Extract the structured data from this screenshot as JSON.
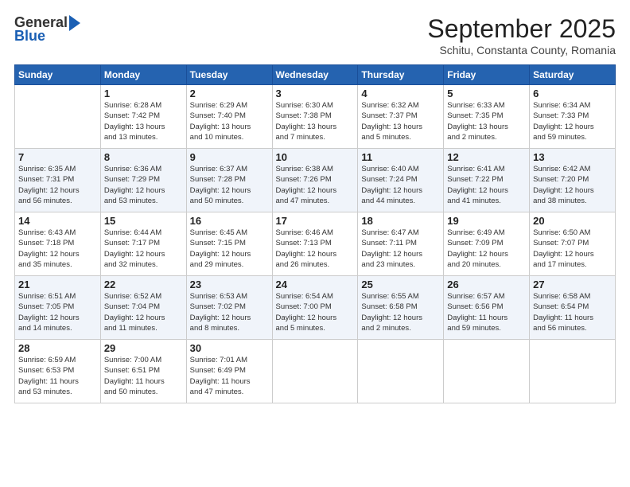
{
  "header": {
    "logo_general": "General",
    "logo_blue": "Blue",
    "month_title": "September 2025",
    "subtitle": "Schitu, Constanta County, Romania"
  },
  "weekdays": [
    "Sunday",
    "Monday",
    "Tuesday",
    "Wednesday",
    "Thursday",
    "Friday",
    "Saturday"
  ],
  "weeks": [
    [
      {
        "day": "",
        "info": ""
      },
      {
        "day": "1",
        "info": "Sunrise: 6:28 AM\nSunset: 7:42 PM\nDaylight: 13 hours\nand 13 minutes."
      },
      {
        "day": "2",
        "info": "Sunrise: 6:29 AM\nSunset: 7:40 PM\nDaylight: 13 hours\nand 10 minutes."
      },
      {
        "day": "3",
        "info": "Sunrise: 6:30 AM\nSunset: 7:38 PM\nDaylight: 13 hours\nand 7 minutes."
      },
      {
        "day": "4",
        "info": "Sunrise: 6:32 AM\nSunset: 7:37 PM\nDaylight: 13 hours\nand 5 minutes."
      },
      {
        "day": "5",
        "info": "Sunrise: 6:33 AM\nSunset: 7:35 PM\nDaylight: 13 hours\nand 2 minutes."
      },
      {
        "day": "6",
        "info": "Sunrise: 6:34 AM\nSunset: 7:33 PM\nDaylight: 12 hours\nand 59 minutes."
      }
    ],
    [
      {
        "day": "7",
        "info": "Sunrise: 6:35 AM\nSunset: 7:31 PM\nDaylight: 12 hours\nand 56 minutes."
      },
      {
        "day": "8",
        "info": "Sunrise: 6:36 AM\nSunset: 7:29 PM\nDaylight: 12 hours\nand 53 minutes."
      },
      {
        "day": "9",
        "info": "Sunrise: 6:37 AM\nSunset: 7:28 PM\nDaylight: 12 hours\nand 50 minutes."
      },
      {
        "day": "10",
        "info": "Sunrise: 6:38 AM\nSunset: 7:26 PM\nDaylight: 12 hours\nand 47 minutes."
      },
      {
        "day": "11",
        "info": "Sunrise: 6:40 AM\nSunset: 7:24 PM\nDaylight: 12 hours\nand 44 minutes."
      },
      {
        "day": "12",
        "info": "Sunrise: 6:41 AM\nSunset: 7:22 PM\nDaylight: 12 hours\nand 41 minutes."
      },
      {
        "day": "13",
        "info": "Sunrise: 6:42 AM\nSunset: 7:20 PM\nDaylight: 12 hours\nand 38 minutes."
      }
    ],
    [
      {
        "day": "14",
        "info": "Sunrise: 6:43 AM\nSunset: 7:18 PM\nDaylight: 12 hours\nand 35 minutes."
      },
      {
        "day": "15",
        "info": "Sunrise: 6:44 AM\nSunset: 7:17 PM\nDaylight: 12 hours\nand 32 minutes."
      },
      {
        "day": "16",
        "info": "Sunrise: 6:45 AM\nSunset: 7:15 PM\nDaylight: 12 hours\nand 29 minutes."
      },
      {
        "day": "17",
        "info": "Sunrise: 6:46 AM\nSunset: 7:13 PM\nDaylight: 12 hours\nand 26 minutes."
      },
      {
        "day": "18",
        "info": "Sunrise: 6:47 AM\nSunset: 7:11 PM\nDaylight: 12 hours\nand 23 minutes."
      },
      {
        "day": "19",
        "info": "Sunrise: 6:49 AM\nSunset: 7:09 PM\nDaylight: 12 hours\nand 20 minutes."
      },
      {
        "day": "20",
        "info": "Sunrise: 6:50 AM\nSunset: 7:07 PM\nDaylight: 12 hours\nand 17 minutes."
      }
    ],
    [
      {
        "day": "21",
        "info": "Sunrise: 6:51 AM\nSunset: 7:05 PM\nDaylight: 12 hours\nand 14 minutes."
      },
      {
        "day": "22",
        "info": "Sunrise: 6:52 AM\nSunset: 7:04 PM\nDaylight: 12 hours\nand 11 minutes."
      },
      {
        "day": "23",
        "info": "Sunrise: 6:53 AM\nSunset: 7:02 PM\nDaylight: 12 hours\nand 8 minutes."
      },
      {
        "day": "24",
        "info": "Sunrise: 6:54 AM\nSunset: 7:00 PM\nDaylight: 12 hours\nand 5 minutes."
      },
      {
        "day": "25",
        "info": "Sunrise: 6:55 AM\nSunset: 6:58 PM\nDaylight: 12 hours\nand 2 minutes."
      },
      {
        "day": "26",
        "info": "Sunrise: 6:57 AM\nSunset: 6:56 PM\nDaylight: 11 hours\nand 59 minutes."
      },
      {
        "day": "27",
        "info": "Sunrise: 6:58 AM\nSunset: 6:54 PM\nDaylight: 11 hours\nand 56 minutes."
      }
    ],
    [
      {
        "day": "28",
        "info": "Sunrise: 6:59 AM\nSunset: 6:53 PM\nDaylight: 11 hours\nand 53 minutes."
      },
      {
        "day": "29",
        "info": "Sunrise: 7:00 AM\nSunset: 6:51 PM\nDaylight: 11 hours\nand 50 minutes."
      },
      {
        "day": "30",
        "info": "Sunrise: 7:01 AM\nSunset: 6:49 PM\nDaylight: 11 hours\nand 47 minutes."
      },
      {
        "day": "",
        "info": ""
      },
      {
        "day": "",
        "info": ""
      },
      {
        "day": "",
        "info": ""
      },
      {
        "day": "",
        "info": ""
      }
    ]
  ]
}
